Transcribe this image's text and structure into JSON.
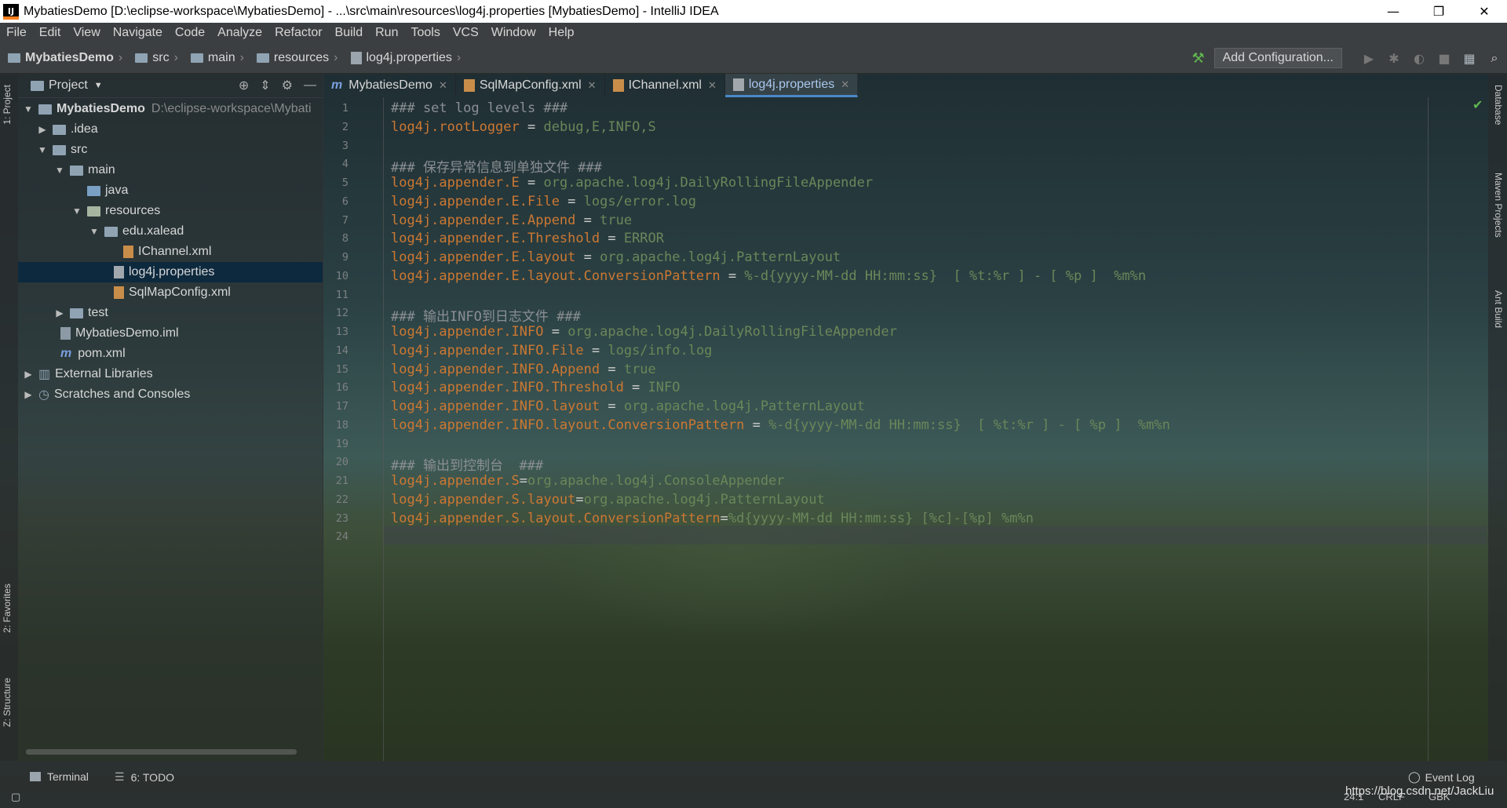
{
  "window": {
    "title": "MybatiesDemo [D:\\eclipse-workspace\\MybatiesDemo] - ...\\src\\main\\resources\\log4j.properties [MybatiesDemo] - IntelliJ IDEA",
    "logo": "IJ",
    "minimize": "—",
    "restore": "❐",
    "close": "✕"
  },
  "menu": [
    "File",
    "Edit",
    "View",
    "Navigate",
    "Code",
    "Analyze",
    "Refactor",
    "Build",
    "Run",
    "Tools",
    "VCS",
    "Window",
    "Help"
  ],
  "breadcrumb": [
    "MybatiesDemo",
    "src",
    "main",
    "resources",
    "log4j.properties"
  ],
  "toolbar": {
    "add_configuration": "Add Configuration..."
  },
  "project_panel": {
    "title": "Project",
    "tree": [
      {
        "label": "MybatiesDemo",
        "extra": "D:\\eclipse-workspace\\Mybati"
      },
      {
        "label": ".idea"
      },
      {
        "label": "src"
      },
      {
        "label": "main"
      },
      {
        "label": "java"
      },
      {
        "label": "resources"
      },
      {
        "label": "edu.xalead"
      },
      {
        "label": "IChannel.xml"
      },
      {
        "label": "log4j.properties"
      },
      {
        "label": "SqlMapConfig.xml"
      },
      {
        "label": "test"
      },
      {
        "label": "MybatiesDemo.iml"
      },
      {
        "label": "pom.xml"
      },
      {
        "label": "External Libraries"
      },
      {
        "label": "Scratches and Consoles"
      }
    ]
  },
  "editor_tabs": [
    {
      "label": "MybatiesDemo"
    },
    {
      "label": "SqlMapConfig.xml"
    },
    {
      "label": "IChannel.xml"
    },
    {
      "label": "log4j.properties"
    }
  ],
  "code_lines": [
    {
      "n": "1",
      "comment": "### set log levels ###"
    },
    {
      "n": "2",
      "key": "log4j.rootLogger",
      "eq": " = ",
      "val": "debug,E,INFO,S"
    },
    {
      "n": "3"
    },
    {
      "n": "4",
      "comment": "### 保存异常信息到单独文件 ###"
    },
    {
      "n": "5",
      "key": "log4j.appender.E",
      "eq": " = ",
      "val": "org.apache.log4j.DailyRollingFileAppender"
    },
    {
      "n": "6",
      "key": "log4j.appender.E.File",
      "eq": " = ",
      "val": "logs/error.log"
    },
    {
      "n": "7",
      "key": "log4j.appender.E.Append",
      "eq": " = ",
      "val": "true"
    },
    {
      "n": "8",
      "key": "log4j.appender.E.Threshold",
      "eq": " = ",
      "val": "ERROR"
    },
    {
      "n": "9",
      "key": "log4j.appender.E.layout",
      "eq": " = ",
      "val": "org.apache.log4j.PatternLayout"
    },
    {
      "n": "10",
      "key": "log4j.appender.E.layout.ConversionPattern",
      "eq": " = ",
      "val": "%-d{yyyy-MM-dd HH:mm:ss}  [ %t:%r ] - [ %p ]  %m%n"
    },
    {
      "n": "11"
    },
    {
      "n": "12",
      "comment": "### 输出INFO到日志文件 ###"
    },
    {
      "n": "13",
      "key": "log4j.appender.INFO",
      "eq": " = ",
      "val": "org.apache.log4j.DailyRollingFileAppender"
    },
    {
      "n": "14",
      "key": "log4j.appender.INFO.File",
      "eq": " = ",
      "val": "logs/info.log"
    },
    {
      "n": "15",
      "key": "log4j.appender.INFO.Append",
      "eq": " = ",
      "val": "true"
    },
    {
      "n": "16",
      "key": "log4j.appender.INFO.Threshold",
      "eq": " = ",
      "val": "INFO"
    },
    {
      "n": "17",
      "key": "log4j.appender.INFO.layout",
      "eq": " = ",
      "val": "org.apache.log4j.PatternLayout"
    },
    {
      "n": "18",
      "key": "log4j.appender.INFO.layout.ConversionPattern",
      "eq": " = ",
      "val": "%-d{yyyy-MM-dd HH:mm:ss}  [ %t:%r ] - [ %p ]  %m%n"
    },
    {
      "n": "19"
    },
    {
      "n": "20",
      "comment": "### 输出到控制台  ###"
    },
    {
      "n": "21",
      "key": "log4j.appender.S",
      "eq": "=",
      "val": "org.apache.log4j.ConsoleAppender"
    },
    {
      "n": "22",
      "key": "log4j.appender.S.layout",
      "eq": "=",
      "val": "org.apache.log4j.PatternLayout"
    },
    {
      "n": "23",
      "key": "log4j.appender.S.layout.ConversionPattern",
      "eq": "=",
      "val": "%d{yyyy-MM-dd HH:mm:ss} [%c]-[%p] %m%n"
    },
    {
      "n": "24"
    }
  ],
  "side_tabs": {
    "left": [
      "1: Project",
      "2: Favorites",
      "Z: Structure"
    ],
    "right": [
      "Database",
      "Maven Projects",
      "Ant Build"
    ]
  },
  "bottom": {
    "terminal": "Terminal",
    "todo": "6: TODO",
    "event_log": "Event Log",
    "status_pos": "24:1",
    "status_crlf": "CRLF",
    "status_enc": "GBK",
    "watermark": "https://blog.csdn.net/JackLiu"
  }
}
